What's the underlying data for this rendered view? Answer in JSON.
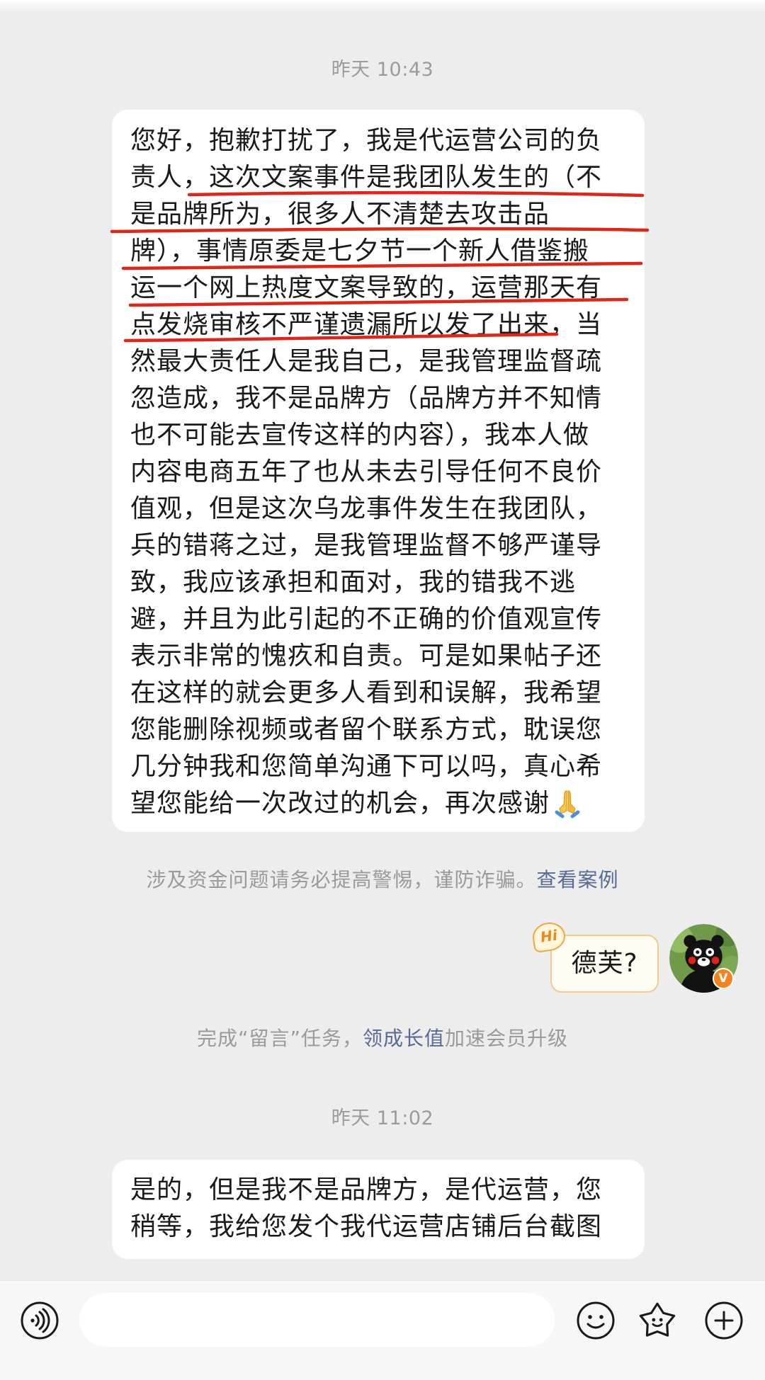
{
  "timestamps": {
    "first": "昨天 10:43",
    "second": "昨天 11:02"
  },
  "incoming_message_1": {
    "lines": [
      "您好，抱歉打扰了，我是代运营公司的负",
      "责人，这次文案事件是我团队发生的（不",
      "是品牌所为，很多人不清楚去攻击品",
      "牌），事情原委是七夕节一个新人借鉴搬",
      "运一个网上热度文案导致的，运营那天有",
      "点发烧审核不严谨遗漏所以发了出来，当",
      "然最大责任人是我自己，是我管理监督疏",
      "忽造成，我不是品牌方（品牌方并不知情",
      "也不可能去宣传这样的内容），我本人做",
      "内容电商五年了也从未去引导任何不良价",
      "值观，但是这次乌龙事件发生在我团队，",
      "兵的错蒋之过，是我管理监督不够严谨导",
      "致，我应该承担和面对，我的错我不逃",
      "避，并且为此引起的不正确的价值观宣传",
      "表示非常的愧疚和自责。可是如果帖子还",
      "在这样的就会更多人看到和误解，我希望",
      "您能删除视频或者留个联系方式，耽误您",
      "几分钟我和您简单沟通下可以吗，真心希",
      "望您能给一次改过的机会，再次感谢"
    ],
    "end_icon": "praying-hands-icon",
    "annotation": "red-underline-annotation"
  },
  "safety_notice": {
    "text": "涉及资金问题请务必提高警惕，谨防诈骗。",
    "link": "查看案例"
  },
  "outgoing_message": {
    "text": "德芙?",
    "hi_badge": "Hi",
    "avatar": "kumamon-avatar",
    "verified_badge": "V"
  },
  "task_notice": {
    "prefix": "完成“留言”任务，",
    "link": "领成长值",
    "suffix": "加速会员升级"
  },
  "incoming_message_2": {
    "lines": [
      "是的，但是我不是品牌方，是代运营，您",
      "稍等，我给您发个我代运营店铺后台截图"
    ]
  },
  "input_bar": {
    "icons": [
      "voice-icon",
      "emoji-smiley-icon",
      "sticker-icon",
      "plus-icon"
    ]
  },
  "colors": {
    "background": "#ededed",
    "bubble": "#ffffff",
    "link": "#576b95",
    "annotation_red": "#e1251b",
    "verified_badge": "#f5821f"
  }
}
